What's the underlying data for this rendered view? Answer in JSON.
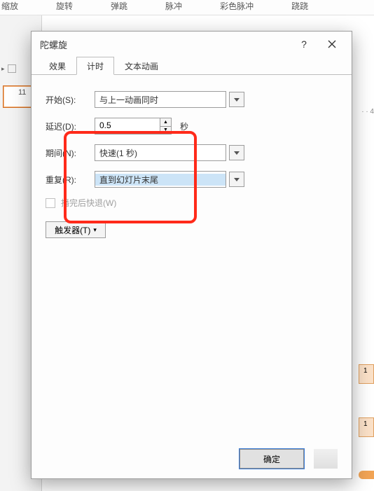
{
  "ribbon": {
    "items": [
      "缩放",
      "旋转",
      "弹跳",
      "脉冲",
      "彩色脉冲",
      "跷跷"
    ]
  },
  "left": {
    "section_icon": "ppt-icon",
    "slide_number": "11"
  },
  "right_rule": "· · 4",
  "dialog": {
    "title": "陀螺旋",
    "help": "?",
    "tabs": {
      "effect": "效果",
      "timing": "计时",
      "text_anim": "文本动画"
    },
    "labels": {
      "start": "开始(S):",
      "delay": "延迟(D):",
      "duration": "期间(N):",
      "repeat": "重复(R):",
      "rewind": "播完后快退(W)",
      "triggers": "触发器(T)"
    },
    "values": {
      "start": "与上一动画同时",
      "delay": "0.5",
      "delay_unit": "秒",
      "duration": "快速(1 秒)",
      "repeat": "直到幻灯片末尾"
    },
    "footer": {
      "ok": "确定"
    }
  },
  "markers": {
    "a": "1",
    "b": "1"
  }
}
